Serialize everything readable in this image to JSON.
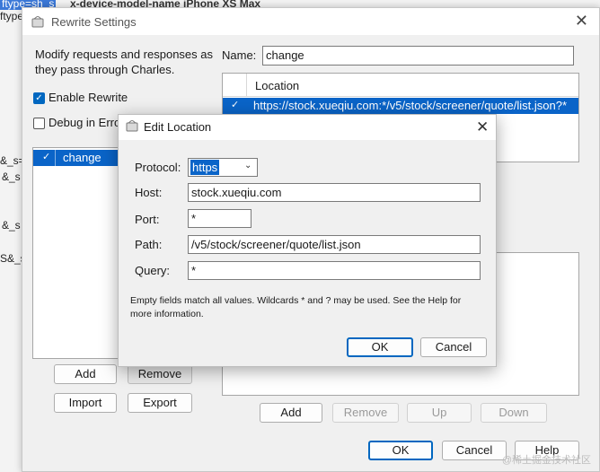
{
  "background": {
    "fragments": [
      {
        "text": "ftype=sh_s",
        "highlight": true
      },
      {
        "text": "ftype",
        "highlight": false
      },
      {
        "text": "&_s=",
        "highlight": false
      },
      {
        "text": "&_s",
        "highlight": false
      },
      {
        "text": "&_s",
        "highlight": false
      },
      {
        "text": "S&_s",
        "highlight": false
      }
    ],
    "header_fragment": "x-device-model-name  iPhone XS Max"
  },
  "window": {
    "title": "Rewrite Settings",
    "intro_text": "Modify requests and responses as they pass through Charles.",
    "enable_rewrite_label": "Enable Rewrite",
    "enable_rewrite_checked": true,
    "debug_label": "Debug in Erro",
    "debug_checked": false,
    "sets": [
      {
        "name": "change",
        "checked": true
      }
    ],
    "left_buttons": {
      "add": "Add",
      "remove": "Remove",
      "import": "Import",
      "export": "Export"
    },
    "name_label": "Name:",
    "name_value": "change",
    "location_header": "Location",
    "locations": [
      {
        "url": "https://stock.xueqiu.com:*/v5/stock/screener/quote/list.json?*",
        "checked": true
      }
    ],
    "rules_buttons": {
      "add": "Add",
      "remove": "Remove",
      "up": "Up",
      "down": "Down"
    },
    "footer_buttons": {
      "ok": "OK",
      "cancel": "Cancel",
      "help": "Help"
    }
  },
  "dialog": {
    "title": "Edit Location",
    "protocol_label": "Protocol:",
    "protocol_value": "https",
    "host_label": "Host:",
    "host_value": "stock.xueqiu.com",
    "port_label": "Port:",
    "port_value": "*",
    "path_label": "Path:",
    "path_value": "/v5/stock/screener/quote/list.json",
    "query_label": "Query:",
    "query_value": "*",
    "note": "Empty fields match all values. Wildcards * and ? may be used. See the Help for more information.",
    "ok": "OK",
    "cancel": "Cancel"
  },
  "colors": {
    "accent": "#0067c0",
    "selection": "#0a64c8"
  },
  "watermark": "@稀土掘金技术社区"
}
